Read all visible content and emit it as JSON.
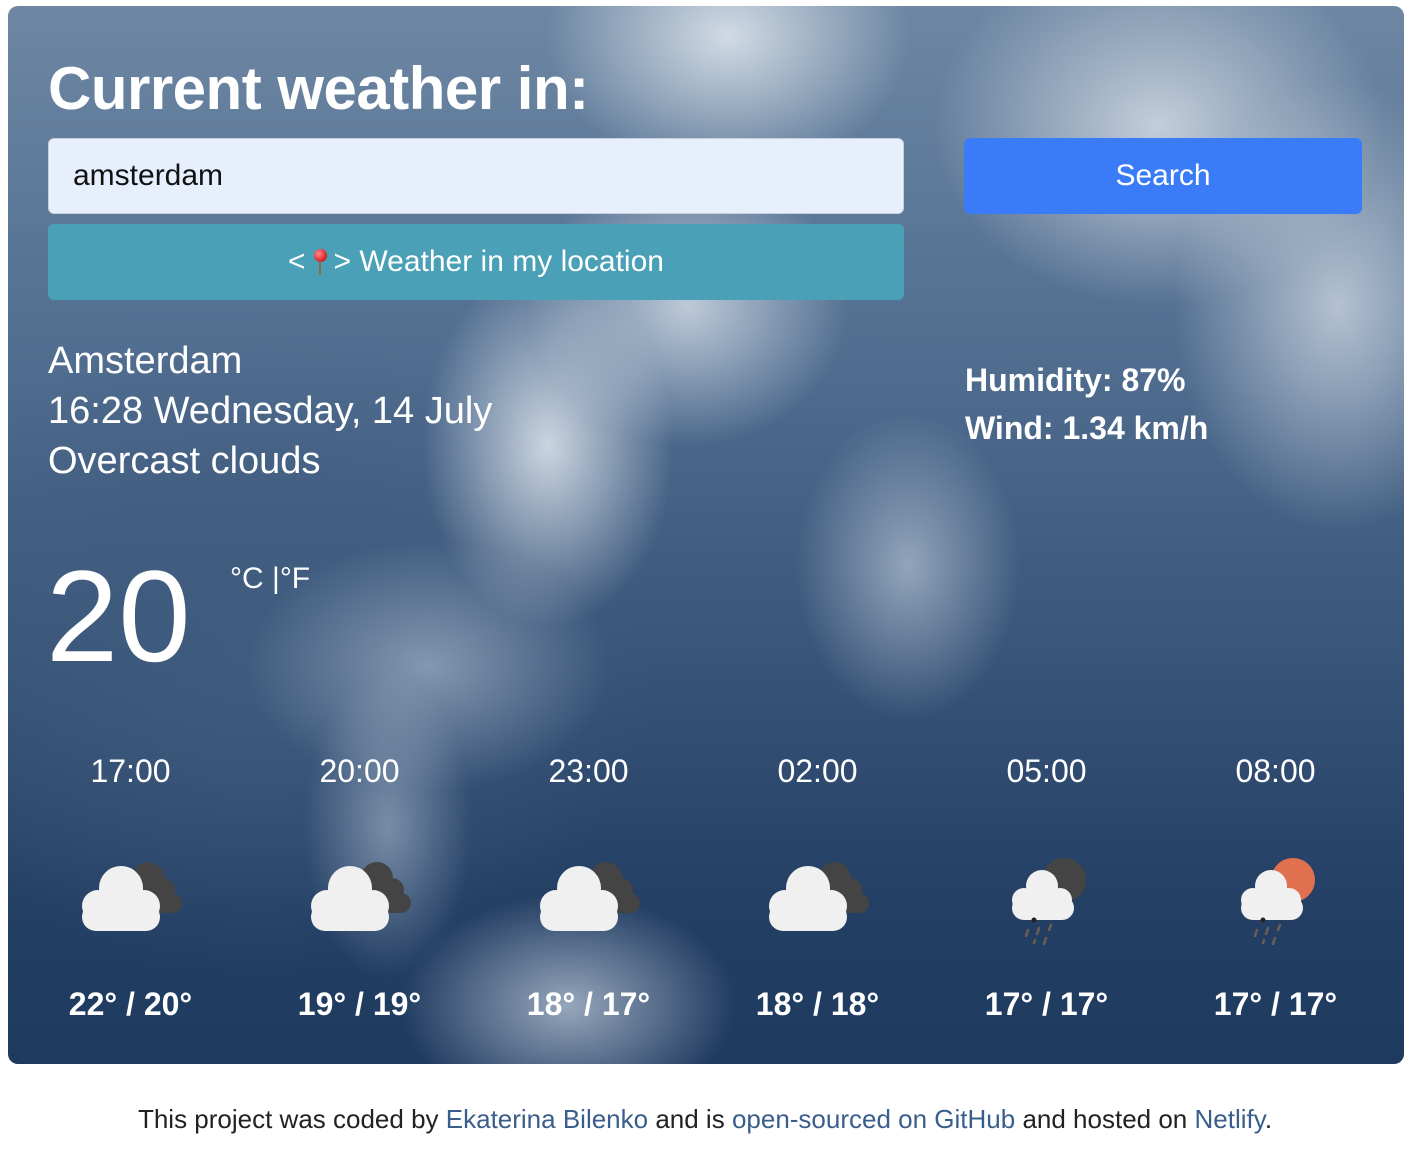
{
  "header": {
    "title": "Current weather in:"
  },
  "search": {
    "value": "amsterdam",
    "button_label": "Search"
  },
  "location_button": {
    "prefix": "<",
    "icon": "round-pushpin-icon",
    "label": "> Weather in my location"
  },
  "current": {
    "city": "Amsterdam",
    "datetime": "16:28 Wednesday, 14 July",
    "description": "Overcast clouds",
    "temperature": "20",
    "unit_celsius": "°C",
    "unit_separator": " |",
    "unit_fahrenheit": "°F",
    "humidity": "Humidity: 87%",
    "wind": "Wind: 1.34 km/h"
  },
  "forecast": [
    {
      "time": "17:00",
      "icon": "broken-clouds-icon",
      "temps": "22° / 20°"
    },
    {
      "time": "20:00",
      "icon": "broken-clouds-icon",
      "temps": "19° / 19°"
    },
    {
      "time": "23:00",
      "icon": "broken-clouds-icon",
      "temps": "18° / 17°"
    },
    {
      "time": "02:00",
      "icon": "broken-clouds-icon",
      "temps": "18° / 18°"
    },
    {
      "time": "05:00",
      "icon": "night-rain-icon",
      "temps": "17° / 17°"
    },
    {
      "time": "08:00",
      "icon": "day-rain-icon",
      "temps": "17° / 17°"
    }
  ],
  "colors": {
    "search_button": "#3a7cf7",
    "location_button": "#4aa0b6",
    "link": "#3a5e8c",
    "sun": "#e07050",
    "moon": "#444444"
  },
  "footer": {
    "text1": "This project was coded by ",
    "link1": "Ekaterina Bilenko",
    "text2": " and is ",
    "link2": "open-sourced on GitHub",
    "text3": " and hosted on ",
    "link3": "Netlify",
    "text4": "."
  }
}
